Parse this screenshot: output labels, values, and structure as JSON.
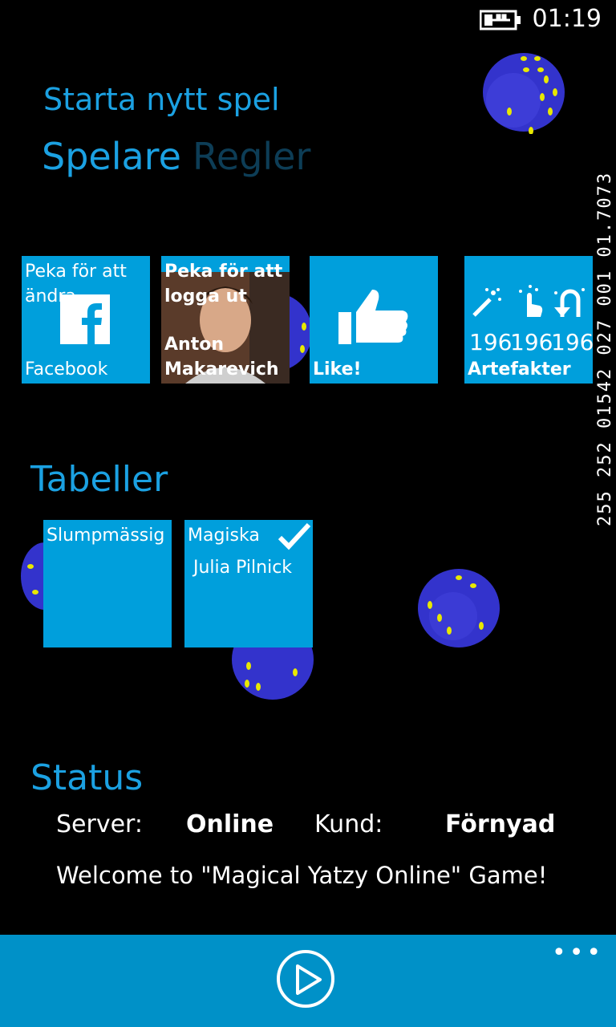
{
  "status_bar": {
    "time": "01:19",
    "battery_icon": "battery-charging-icon",
    "debug_text": "255 252 01542 027 001 01.7073"
  },
  "header": {
    "app_title": "Starta nytt spel",
    "pivot_active": "Spelare",
    "pivot_inactive": "Regler"
  },
  "tiles": {
    "facebook": {
      "top_text": "Peka för att ändra",
      "bottom_text": "Facebook",
      "icon": "facebook-icon"
    },
    "profile": {
      "top_text": "Peka för att logga ut",
      "name": "Anton Makarevich",
      "icon": "avatar"
    },
    "like": {
      "label": "Like!",
      "icon": "thumbs-up-icon"
    },
    "artefakter": {
      "counts": [
        "196",
        "196",
        "196"
      ],
      "label": "Artefakter",
      "icons": [
        "magic-wand-icon",
        "hand-tap-icon",
        "undo-magnet-icon"
      ]
    }
  },
  "tables": {
    "title": "Tabeller",
    "items": [
      {
        "name": "Slumpmässig",
        "owner": ""
      },
      {
        "name": "Magiska",
        "owner": "Julia Pilnick",
        "selected": true
      }
    ]
  },
  "status": {
    "title": "Status",
    "server_label": "Server:",
    "server_value": "Online",
    "client_label": "Kund:",
    "client_value": "Förnyad",
    "welcome": "Welcome to \"Magical Yatzy Online\" Game!"
  },
  "app_bar": {
    "play_icon": "play-icon",
    "more_icon": "more-dots-icon",
    "more_text": "•••"
  },
  "colors": {
    "accent": "#1ba1e2",
    "tile": "#009fdc",
    "dice": "#3333cc",
    "pips": "#e8e800"
  }
}
